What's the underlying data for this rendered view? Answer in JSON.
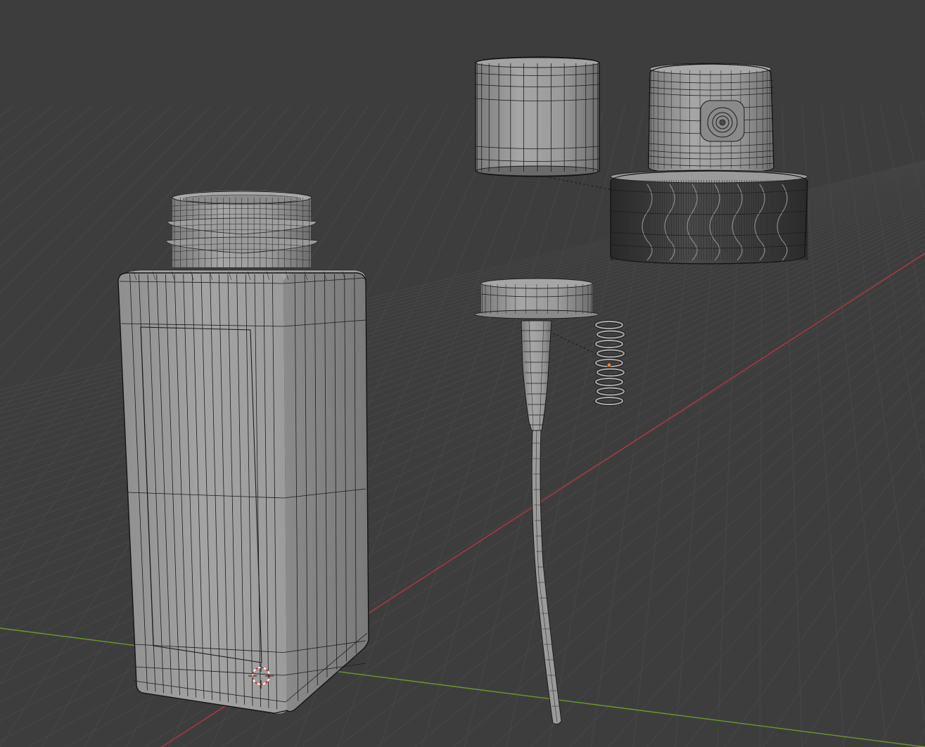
{
  "app": "3D Viewport",
  "viewport": {
    "background": "#3d3d3d",
    "grid_color": "#474747",
    "x_axis_color": "#a33a43",
    "y_axis_color": "#6a9a2c",
    "mesh_face_color": "#9a9a9a",
    "mesh_shadow_color": "#6f6f6f",
    "wire_color": "#1c1c1c",
    "origin_dot_color": "#e8852a",
    "cursor_colors": [
      "#d23b3b",
      "#ffffff"
    ]
  },
  "objects": [
    {
      "name": "bottle-body",
      "icon": "mesh"
    },
    {
      "name": "cap-sleeve",
      "icon": "mesh"
    },
    {
      "name": "spray-nozzle-head",
      "icon": "mesh"
    },
    {
      "name": "threaded-collar",
      "icon": "mesh"
    },
    {
      "name": "pump-stem-dip-tube",
      "icon": "mesh"
    },
    {
      "name": "spring",
      "icon": "mesh"
    }
  ],
  "cursor": {
    "icon": "3d-cursor-icon"
  }
}
